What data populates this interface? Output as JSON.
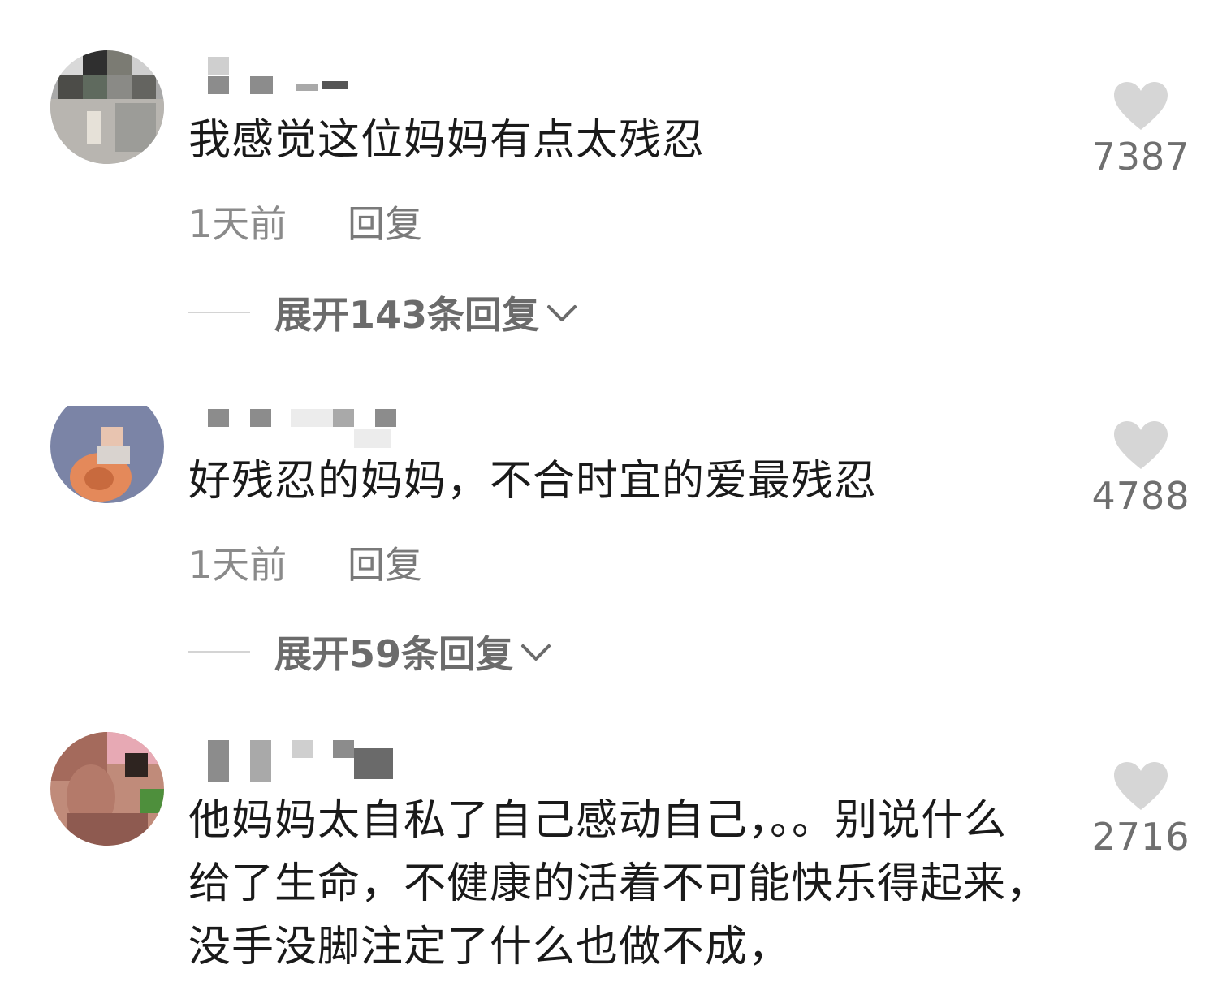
{
  "comments": [
    {
      "text": "我感觉这位妈妈有点太残忍",
      "time": "1天前",
      "reply_label": "回复",
      "expand_label": "展开143条回复",
      "likes": "7387",
      "heart_icon": "heart-icon"
    },
    {
      "text": "好残忍的妈妈，不合时宜的爱最残忍",
      "time": "1天前",
      "reply_label": "回复",
      "expand_label": "展开59条回复",
      "likes": "4788",
      "heart_icon": "heart-icon"
    },
    {
      "text": "他妈妈太自私了自己感动自己，。。别说什么给了生命，不健康的活着不可能快乐得起来，没手没脚注定了什么也做不成，",
      "likes": "2716",
      "heart_icon": "heart-icon"
    }
  ],
  "colors": {
    "text": "#1a1a1a",
    "meta": "#8a8a8a",
    "heart": "#d6d6d6",
    "count": "#6f6f6f"
  }
}
